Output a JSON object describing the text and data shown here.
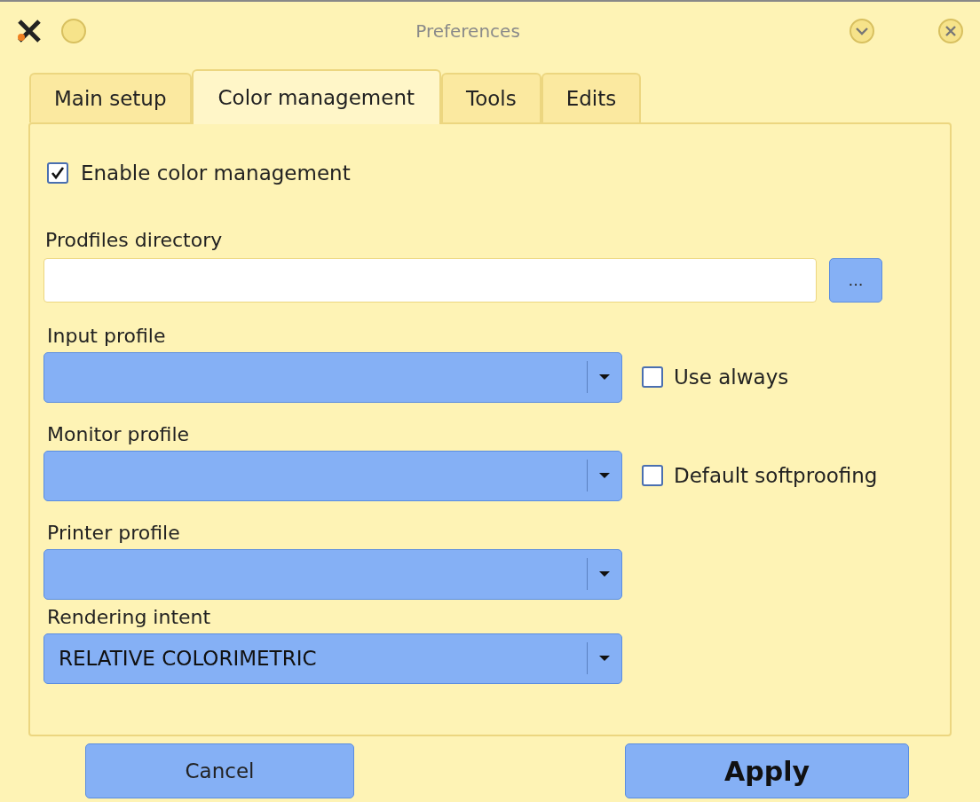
{
  "window": {
    "title": "Preferences"
  },
  "tabs": [
    {
      "label": "Main setup",
      "selected": false
    },
    {
      "label": "Color management",
      "selected": true
    },
    {
      "label": "Tools",
      "selected": false
    },
    {
      "label": "Edits",
      "selected": false
    }
  ],
  "enable": {
    "label": "Enable color management",
    "checked": true
  },
  "directory": {
    "label": "Prodfiles directory",
    "browse": "..."
  },
  "profiles": [
    {
      "label": "Input profile",
      "option": {
        "label": "Use always",
        "checked": false
      }
    },
    {
      "label": "Monitor profile",
      "option": {
        "label": "Default softproofing",
        "checked": false
      }
    },
    {
      "label": "Printer profile"
    },
    {
      "label": "Rendering intent",
      "value": "RELATIVE COLORIMETRIC"
    }
  ],
  "buttons": [
    {
      "label": "Cancel",
      "kind": "normal"
    },
    {
      "label": "Apply",
      "kind": "default"
    }
  ]
}
